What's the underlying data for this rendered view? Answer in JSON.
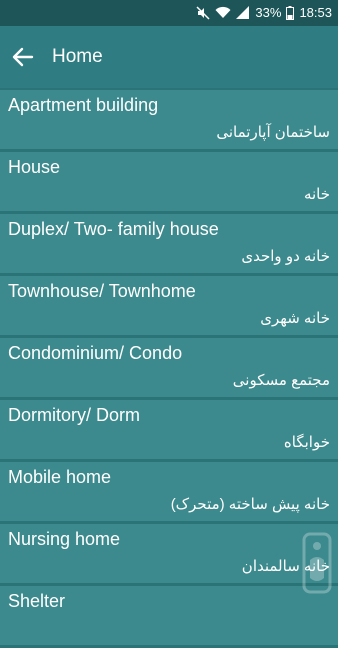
{
  "status_bar": {
    "battery": "33%",
    "time": "18:53",
    "icons": [
      "mute-icon",
      "wifi-icon",
      "signal-icon",
      "battery-icon"
    ]
  },
  "app_bar": {
    "title": "Home",
    "back_icon": "arrow-left-icon"
  },
  "items": [
    {
      "en": "Apartment building",
      "fa": "ساختمان آپارتمانی"
    },
    {
      "en": "House",
      "fa": "خانه"
    },
    {
      "en": "Duplex/ Two- family house",
      "fa": "خانه دو واحدی"
    },
    {
      "en": "Townhouse/ Townhome",
      "fa": "خانه شهری"
    },
    {
      "en": "Condominium/ Condo",
      "fa": "مجتمع مسکونی"
    },
    {
      "en": "Dormitory/ Dorm",
      "fa": "خوابگاه"
    },
    {
      "en": "Mobile home",
      "fa": "خانه پیش ساخته (متحرک)"
    },
    {
      "en": "Nursing home",
      "fa": "خانه سالمندان"
    },
    {
      "en": "Shelter",
      "fa": ""
    }
  ],
  "colors": {
    "status_bar": "#1d5558",
    "app_bar": "#2f7d82",
    "item_background": "#3c8a8d",
    "page_background": "#2a7377",
    "text": "#ffffff"
  }
}
